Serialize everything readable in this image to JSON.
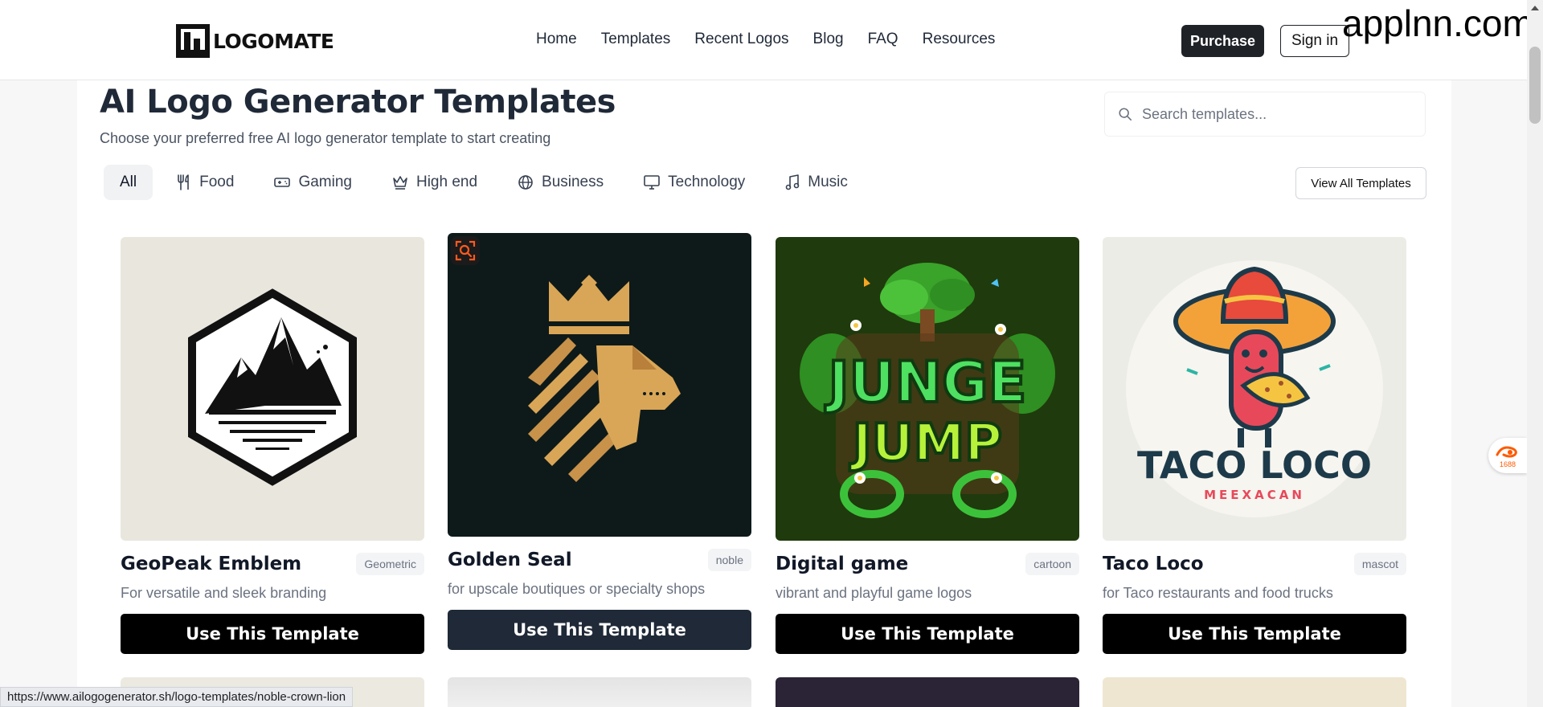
{
  "brand": {
    "name": "LOGOMATE"
  },
  "watermark": "applnn.com",
  "nav": {
    "items": [
      "Home",
      "Templates",
      "Recent Logos",
      "Blog",
      "FAQ",
      "Resources"
    ]
  },
  "header": {
    "purchase_label": "Purchase",
    "signin_label": "Sign in"
  },
  "page": {
    "title": "AI Logo Generator Templates",
    "subtitle": "Choose your preferred free AI logo generator template to start creating"
  },
  "search": {
    "placeholder": "Search templates..."
  },
  "tabs": [
    {
      "label": "All",
      "icon": "none",
      "active": true
    },
    {
      "label": "Food",
      "icon": "utensils-icon"
    },
    {
      "label": "Gaming",
      "icon": "gamepad-icon"
    },
    {
      "label": "High end",
      "icon": "crown-icon"
    },
    {
      "label": "Business",
      "icon": "globe-icon"
    },
    {
      "label": "Technology",
      "icon": "monitor-icon"
    },
    {
      "label": "Music",
      "icon": "music-note-icon"
    }
  ],
  "view_all_label": "View All Templates",
  "cards": [
    {
      "title": "GeoPeak Emblem",
      "badge": "Geometric",
      "desc": "For versatile and sleek branding",
      "button": "Use This Template"
    },
    {
      "title": "Golden Seal",
      "badge": "noble",
      "desc": "for upscale boutiques or specialty shops",
      "button": "Use This Template"
    },
    {
      "title": "Digital game",
      "badge": "cartoon",
      "desc": "vibrant and playful game logos",
      "button": "Use This Template"
    },
    {
      "title": "Taco Loco",
      "badge": "mascot",
      "desc": "for Taco restaurants and food trucks",
      "button": "Use This Template"
    }
  ],
  "card_art": {
    "game_line1": "JUNGE",
    "game_line2": "JUMP",
    "taco_line1": "TACO LOCO",
    "taco_line2": "MEEXACAN"
  },
  "status_url": "https://www.ailogogenerator.sh/logo-templates/noble-crown-lion",
  "side_badge": "1688",
  "colors": {
    "dark": "#1f2328",
    "button": "#000000",
    "hover_button": "#1f2937",
    "lion_bg": "#0e1a1a",
    "gold": "#d9a657"
  }
}
